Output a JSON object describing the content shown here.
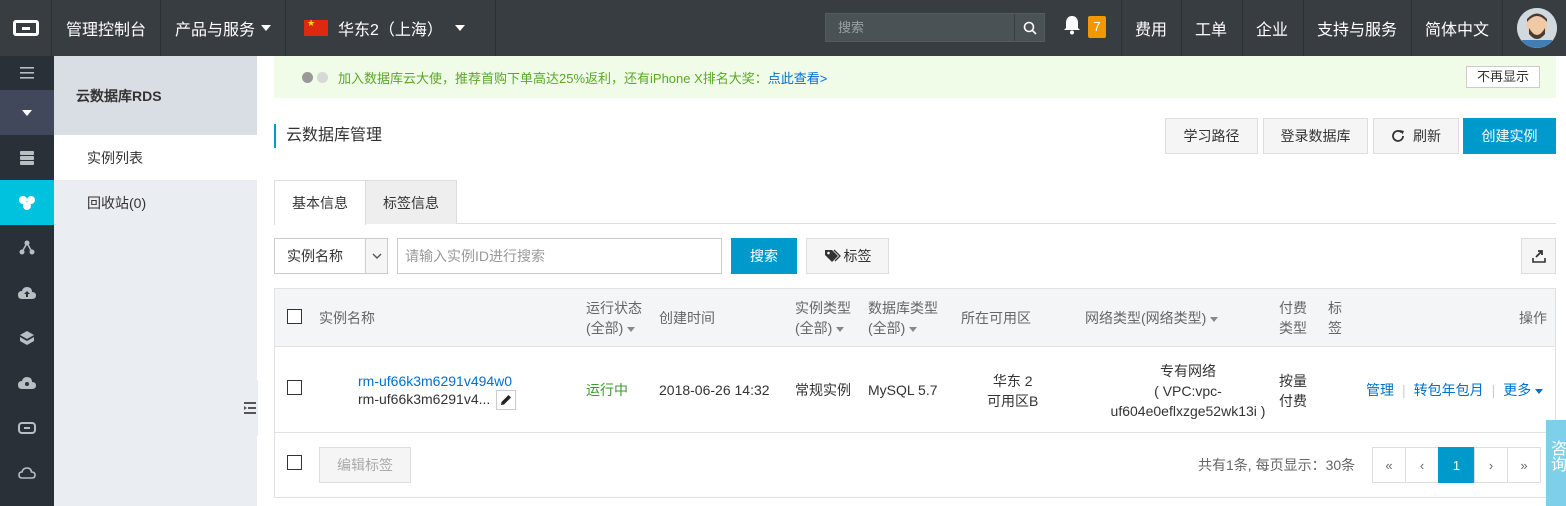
{
  "topbar": {
    "console": "管理控制台",
    "products": "产品与服务",
    "region": "华东2（上海）",
    "search_placeholder": "搜索",
    "notification_count": "7",
    "fees": "费用",
    "tickets": "工单",
    "enterprise": "企业",
    "support": "支持与服务",
    "language": "简体中文"
  },
  "sidebar": {
    "title": "云数据库RDS",
    "items": [
      {
        "label": "实例列表"
      },
      {
        "label": "回收站(0)"
      }
    ]
  },
  "promo": {
    "text": "加入数据库云大使，推荐首购下单高达25%返利，还有iPhone X排名大奖：",
    "link": "点此查看>",
    "dismiss": "不再显示"
  },
  "page": {
    "title": "云数据库管理",
    "actions": {
      "learn": "学习路径",
      "login_db": "登录数据库",
      "refresh": "刷新",
      "create": "创建实例"
    }
  },
  "tabs": [
    {
      "label": "基本信息",
      "active": true
    },
    {
      "label": "标签信息",
      "active": false
    }
  ],
  "filter": {
    "select_value": "实例名称",
    "input_placeholder": "请输入实例ID进行搜索",
    "search": "搜索",
    "tags": "标签"
  },
  "table": {
    "headers": {
      "name": "实例名称",
      "status": "运行状态",
      "status_sub": "(全部)",
      "created": "创建时间",
      "type": "实例类型",
      "type_sub": "(全部)",
      "db_type": "数据库类型",
      "db_type_sub": "(全部)",
      "zone": "所在可用区",
      "network": "网络类型(网络类型)",
      "pay": "付费",
      "pay2": "类型",
      "tag": "标",
      "tag2": "签",
      "ops": "操作"
    },
    "rows": [
      {
        "id": "rm-uf66k3m6291v494w0",
        "name": "rm-uf66k3m6291v4...",
        "status": "运行中",
        "created": "2018-06-26 14:32",
        "type": "常规实例",
        "db": "MySQL 5.7",
        "zone1": "华东 2",
        "zone2": "可用区B",
        "net1": "专有网络",
        "net2": "( VPC:vpc-",
        "net3": "uf604e0eflxzge52wk13i )",
        "pay1": "按量",
        "pay2": "付费",
        "op_manage": "管理",
        "op_renew": "转包年包月",
        "op_more": "更多"
      }
    ],
    "footer": {
      "edit_tags": "编辑标签",
      "summary": "共有1条, 每页显示：30条",
      "pager": [
        "«",
        "‹",
        "1",
        "›",
        "»"
      ]
    }
  },
  "consult": "咨询"
}
